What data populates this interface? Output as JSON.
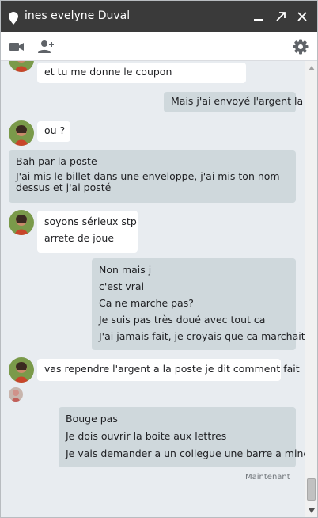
{
  "window": {
    "title": "ines evelyne Duval"
  },
  "titlebar": {
    "icons": [
      "status-icon",
      "minimize-icon",
      "popout-icon",
      "close-icon"
    ]
  },
  "toolbar": {
    "icons": [
      "video-call-icon",
      "add-person-icon",
      "settings-icon"
    ]
  },
  "colors": {
    "titlebar": "#3a3a3a",
    "background": "#e8ecf0",
    "incoming_bubble": "#ffffff",
    "outgoing_bubble": "#cfd8dc"
  },
  "messages": [
    {
      "sender": "contact",
      "lines": [
        "et tu me donne le coupon"
      ]
    },
    {
      "sender": "me",
      "lines": [
        "Mais j'ai envoyé l'argent la"
      ]
    },
    {
      "sender": "contact",
      "lines": [
        "ou ?"
      ]
    },
    {
      "sender": "contact",
      "lines": [
        "Bah par la poste",
        "J'ai mis le billet dans une enveloppe, j'ai mis ton nom",
        "dessus et j'ai posté"
      ]
    },
    {
      "sender": "contact",
      "lines": [
        "soyons sérieux  stp",
        "arrete de joue"
      ]
    },
    {
      "sender": "me",
      "lines": [
        "Non mais j",
        "c'est vrai",
        "Ca ne marche pas?",
        "Je suis pas très doué avec tout ca",
        "J'ai jamais fait, je croyais que ca marchait"
      ]
    },
    {
      "sender": "contact",
      "lines": [
        "vas rependre l'argent a la poste je dit comment fait"
      ]
    },
    {
      "sender": "me",
      "lines": [
        "Bouge pas",
        "Je dois ouvrir la boite aux lettres",
        "Je vais demander a un collegue une barre a mine"
      ]
    }
  ],
  "timestamp": "Maintenant"
}
